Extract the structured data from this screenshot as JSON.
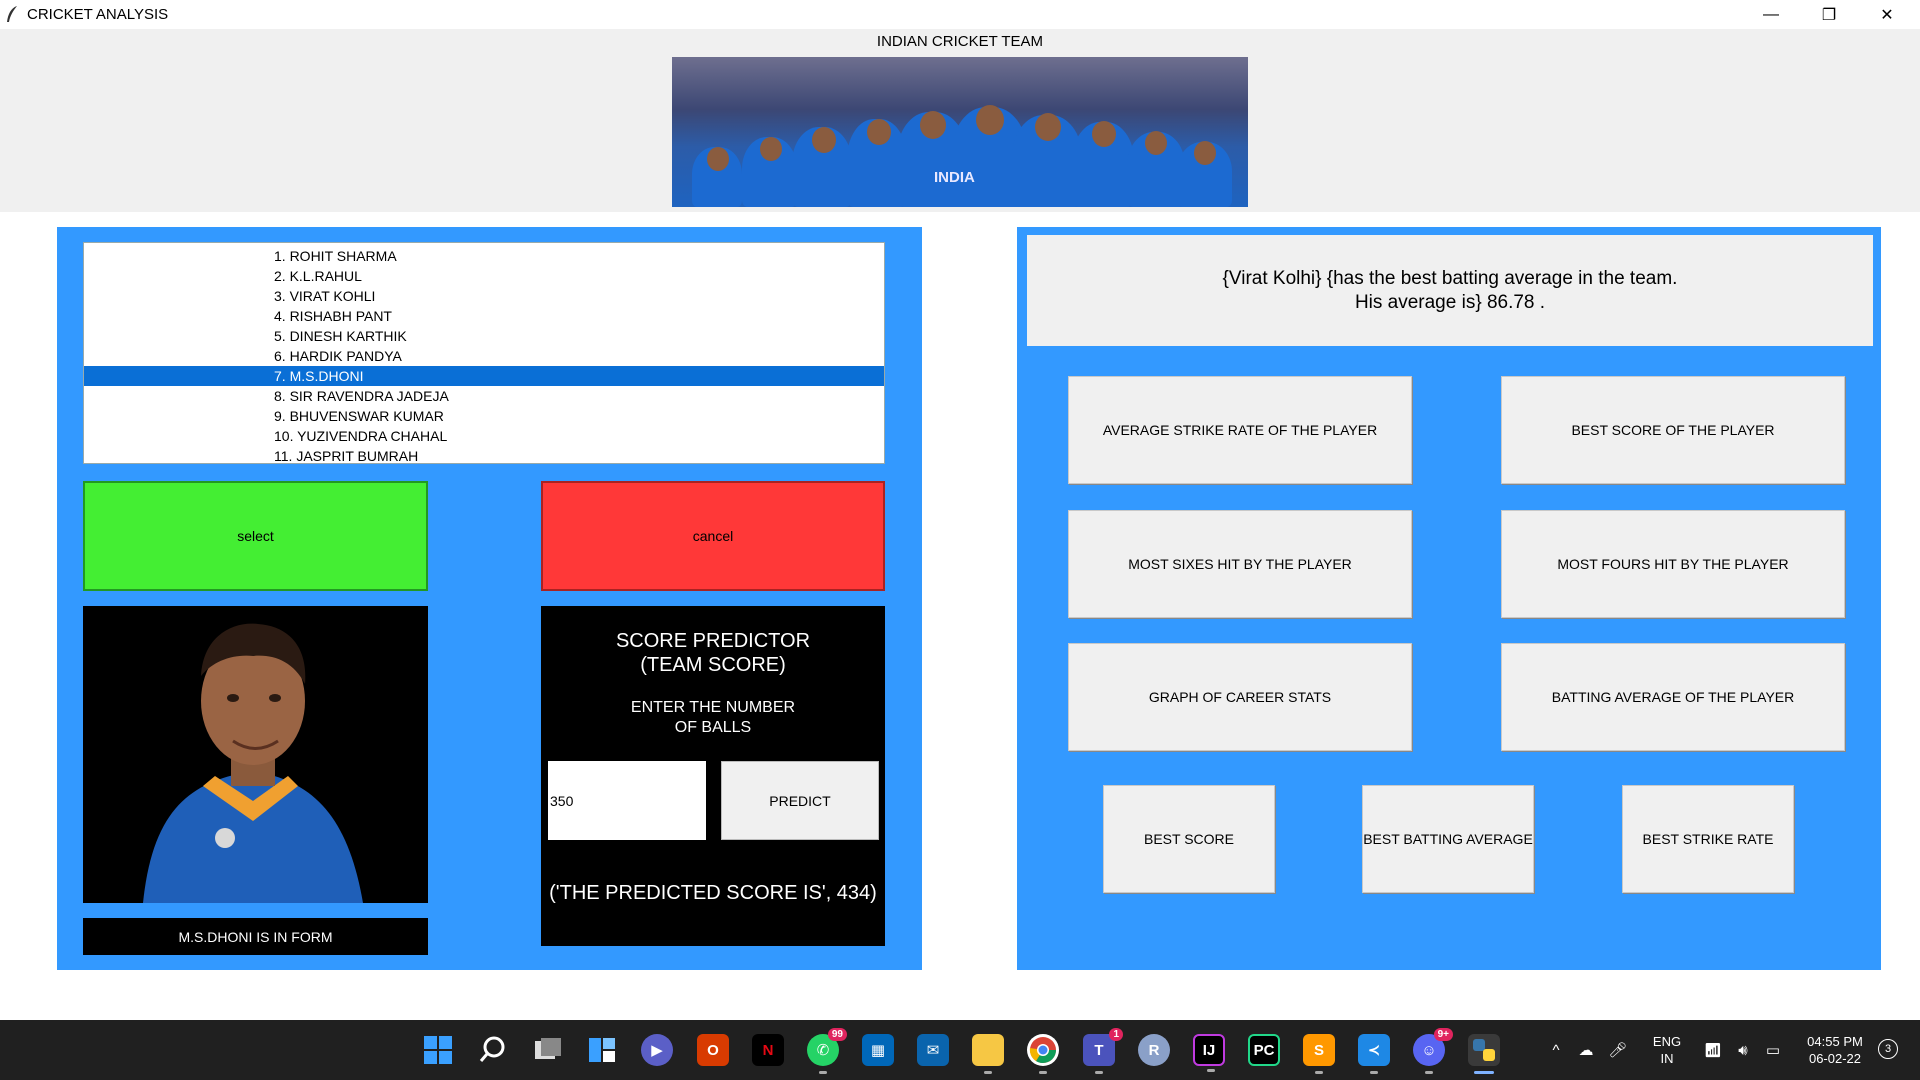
{
  "window": {
    "title": "CRICKET ANALYSIS",
    "minimize": "—",
    "restore": "❐",
    "close": "✕"
  },
  "header": {
    "title": "INDIAN CRICKET TEAM",
    "banner_text": "INDIA"
  },
  "players": {
    "items": [
      "1. ROHIT SHARMA",
      "2. K.L.RAHUL",
      "3. VIRAT KOHLI",
      "4. RISHABH PANT",
      "5. DINESH KARTHIK",
      "6. HARDIK PANDYA",
      "7. M.S.DHONI",
      "8. SIR RAVENDRA JADEJA",
      "9. BHUVENSWAR KUMAR",
      "10. YUZIVENDRA CHAHAL",
      "11. JASPRIT BUMRAH"
    ],
    "selected_index": 6
  },
  "buttons": {
    "select": "select",
    "cancel": "cancel"
  },
  "player_status": "M.S.DHONI IS IN FORM",
  "predictor": {
    "title_line1": "SCORE PREDICTOR",
    "title_line2": "(TEAM SCORE)",
    "sub_line1": "ENTER THE NUMBER",
    "sub_line2": "OF BALLS",
    "input_value": "350",
    "button": "PREDICT",
    "result": "('THE PREDICTED SCORE IS', 434)"
  },
  "message": {
    "line1": "{Virat Kolhi} {has the best batting average in the team.",
    "line2": "His average is} 86.78 ."
  },
  "options": {
    "avg_strike_rate": "AVERAGE STRIKE RATE OF THE PLAYER",
    "best_score_player": "BEST SCORE OF THE PLAYER",
    "most_sixes": "MOST SIXES HIT BY THE PLAYER",
    "most_fours": "MOST FOURS HIT BY THE PLAYER",
    "career_graph": "GRAPH OF CAREER STATS",
    "batting_avg_player": "BATTING AVERAGE OF THE PLAYER",
    "best_score": "BEST SCORE",
    "best_batting_avg": "BEST BATTING AVERAGE",
    "best_strike_rate": "BEST STRIKE RATE"
  },
  "taskbar": {
    "whatsapp_badge": "99",
    "teams_badge": "1",
    "discord_badge": "9+",
    "lang_line1": "ENG",
    "lang_line2": "IN",
    "time": "04:55 PM",
    "date": "06-02-22",
    "notif_count": "3",
    "colors": {
      "start": "#3aa0ff",
      "netflix": "#e50914",
      "whatsapp": "#25d366",
      "vscode": "#1e88e5"
    }
  }
}
